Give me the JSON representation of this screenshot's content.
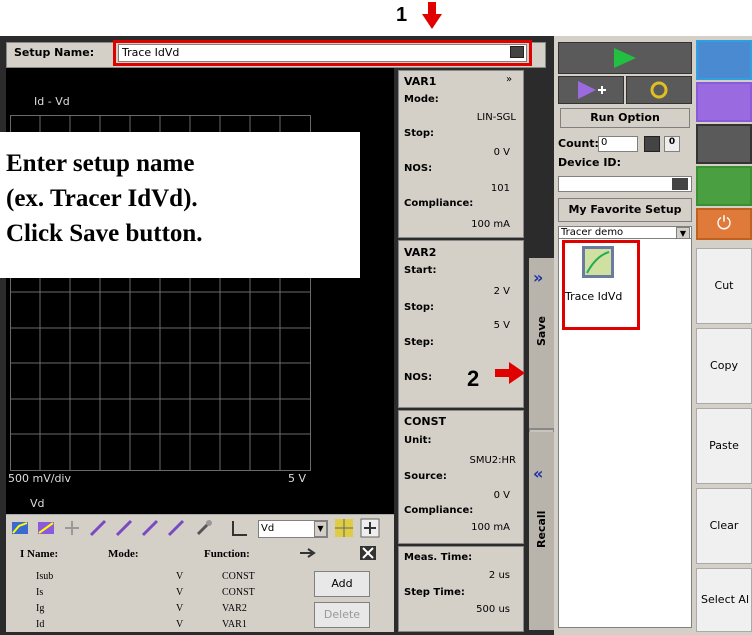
{
  "annotations": {
    "marker1": "1",
    "marker2": "2",
    "note_lines": [
      "Enter setup name",
      "(ex. Tracer IdVd).",
      "Click Save button."
    ]
  },
  "setup": {
    "name_label": "Setup Name:",
    "name_value": "Trace IdVd"
  },
  "graph": {
    "title": "Id - Vd",
    "x_div": "500 mV/div",
    "x_max": "5 V",
    "x_label": "Vd"
  },
  "toolbar": {
    "x_select": "Vd"
  },
  "list": {
    "headers": [
      "I Name:",
      "Mode:",
      "Function:"
    ],
    "rows": [
      {
        "name": "Isub",
        "mode": "V",
        "function": "CONST"
      },
      {
        "name": "Is",
        "mode": "V",
        "function": "CONST"
      },
      {
        "name": "Ig",
        "mode": "V",
        "function": "VAR2"
      },
      {
        "name": "Id",
        "mode": "V",
        "function": "VAR1"
      }
    ],
    "add_label": "Add",
    "delete_label": "Delete"
  },
  "var1": {
    "title": "VAR1",
    "mode_label": "Mode:",
    "mode": "LIN-SGL",
    "stop_label": "Stop:",
    "stop": "0 V",
    "nos_label": "NOS:",
    "nos": "101",
    "compliance_label": "Compliance:",
    "compliance": "100 mA"
  },
  "var2": {
    "title": "VAR2",
    "start_label": "Start:",
    "start": "2 V",
    "stop_label": "Stop:",
    "stop": "5 V",
    "step_label": "Step:",
    "nos_label": "NOS:"
  },
  "const": {
    "title": "CONST",
    "unit_label": "Unit:",
    "unit": "SMU2:HR",
    "source_label": "Source:",
    "source": "0 V",
    "compliance_label": "Compliance:",
    "compliance": "100 mA"
  },
  "timing": {
    "meas_label": "Meas. Time:",
    "meas": "2 us",
    "step_label": "Step Time:",
    "step": "500 us"
  },
  "side_tabs": {
    "save": "Save",
    "recall": "Recall"
  },
  "run": {
    "option_label": "Run Option",
    "count_label": "Count:",
    "count": "0",
    "device_label": "Device ID:",
    "favorite_label": "My Favorite Setup",
    "folder": "Tracer demo",
    "setup_item": "Trace IdVd"
  },
  "edit_buttons": [
    "Cut",
    "Copy",
    "Paste",
    "Clear",
    "Select Al"
  ],
  "colors": {
    "highlight": "#e00000",
    "graph_bg": "#000000",
    "panel_bg": "#d4d0c8",
    "run_green": "#22c040",
    "accent_purple": "#8a5ad8"
  }
}
